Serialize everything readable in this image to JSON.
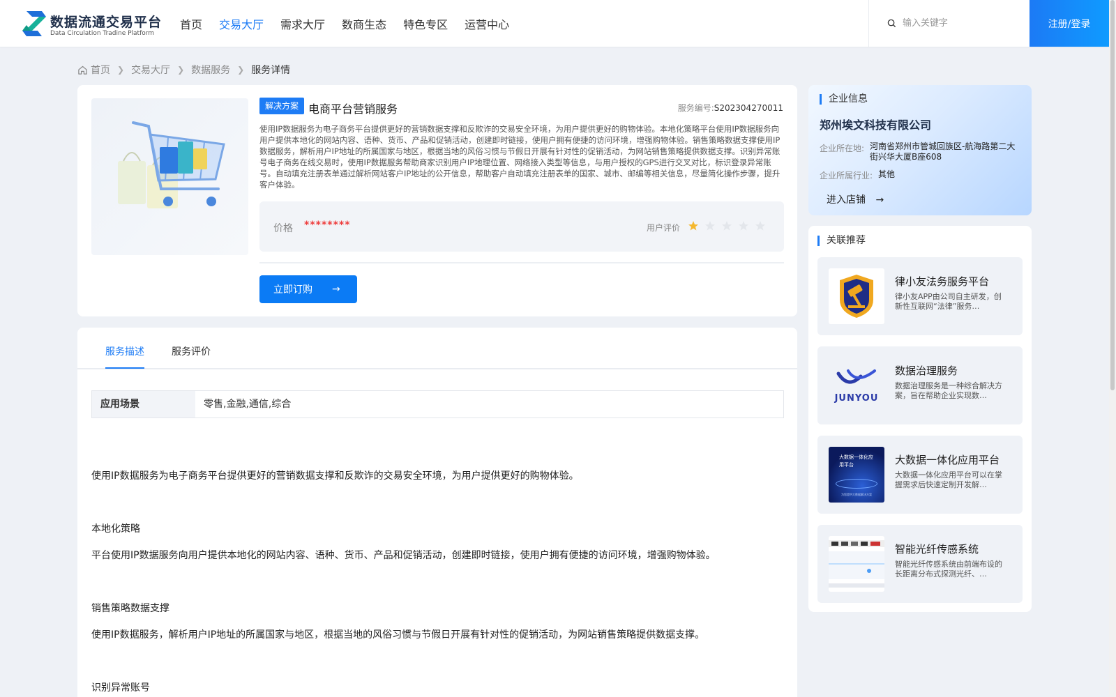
{
  "header": {
    "logo_title": "数据流通交易平台",
    "logo_subtitle": "Data Circulation Tradine Platform",
    "nav": [
      "首页",
      "交易大厅",
      "需求大厅",
      "数商生态",
      "特色专区",
      "运营中心"
    ],
    "active_nav": "交易大厅",
    "search_placeholder": "输入关键字",
    "login_label": "注册/登录"
  },
  "breadcrumb": [
    "首页",
    "交易大厅",
    "数据服务",
    "服务详情"
  ],
  "product": {
    "tag": "解决方案",
    "title": "电商平台营销服务",
    "service_no_label": "服务编号:",
    "service_no": "S202304270011",
    "description": "使用IP数据服务为电子商务平台提供更好的营销数据支撑和反欺诈的交易安全环境，为用户提供更好的购物体验。本地化策略平台使用IP数据服务向用户提供本地化的网站内容、语种、货币、产品和促销活动，创建即时链接，使用户拥有便捷的访问环境，增强购物体验。销售策略数据支撑使用IP数据服务，解析用户IP地址的所属国家与地区，根据当地的风俗习惯与节假日开展有针对性的促销活动，为网站销售策略提供数据支撑。识别异常账号电子商务在线交易时，使用IP数据服务帮助商家识别用户IP地理位置、网络接入类型等信息，与用户授权的GPS进行交叉对比，标识登录异常账号。自动填充注册表单通过解析网站客户IP地址的公开信息，帮助客户自动填充注册表单的国家、城市、邮编等相关信息，尽量简化操作步骤，提升客户体验。",
    "price_label": "价格",
    "price_value": "********",
    "rating_label": "用户评价",
    "rating": 1,
    "rating_max": 5,
    "order_label": "立即订购"
  },
  "tabs": [
    "服务描述",
    "服务评价"
  ],
  "active_tab": "服务描述",
  "scene": {
    "key": "应用场景",
    "value": "零售,金融,通信,综合"
  },
  "paragraphs": [
    "使用IP数据服务为电子商务平台提供更好的营销数据支撑和反欺诈的交易安全环境，为用户提供更好的购物体验。",
    "本地化策略",
    "平台使用IP数据服务向用户提供本地化的网站内容、语种、货币、产品和促销活动，创建即时链接，使用户拥有便捷的访问环境，增强购物体验。",
    "销售策略数据支撑",
    "使用IP数据服务，解析用户IP地址的所属国家与地区，根据当地的风俗习惯与节假日开展有针对性的促销活动，为网站销售策略提供数据支撑。",
    "识别异常账号"
  ],
  "company": {
    "section_title": "企业信息",
    "name": "郑州埃文科技有限公司",
    "location_label": "企业所在地:",
    "location": "河南省郑州市管城回族区-航海路第二大街兴华大厦B座608",
    "industry_label": "企业所属行业:",
    "industry": "其他",
    "store_label": "进入店铺"
  },
  "related": {
    "section_title": "关联推荐",
    "items": [
      {
        "title": "律小友法务服务平台",
        "desc": "律小友APP由公司自主研发，创新性互联网“法律”服务…",
        "icon": "shield-gavel-icon"
      },
      {
        "title": "数据治理服务",
        "desc": "数据治理服务是一种综合解决方案，旨在帮助企业实现数…",
        "icon": "junyou-logo",
        "logo_text": "JUNYOU"
      },
      {
        "title": "大数据一体化应用平台",
        "desc": "大数据一体化应用平台可以在掌握需求后快速定制开发解…",
        "icon": "bigdata-thumb",
        "thumb_text": "大数据一体化应用平台",
        "thumb_caption": "为您提供大数据解决方案"
      },
      {
        "title": "智能光纤传感系统",
        "desc": "智能光纤传感系统由前端布设的长距离分布式探测光纤、…",
        "icon": "fiber-thumb"
      }
    ]
  },
  "colors": {
    "accent": "#1e7cf5",
    "price": "#ee3a3a",
    "star_on": "#f5b82e",
    "star_off": "#e3e6eb"
  }
}
